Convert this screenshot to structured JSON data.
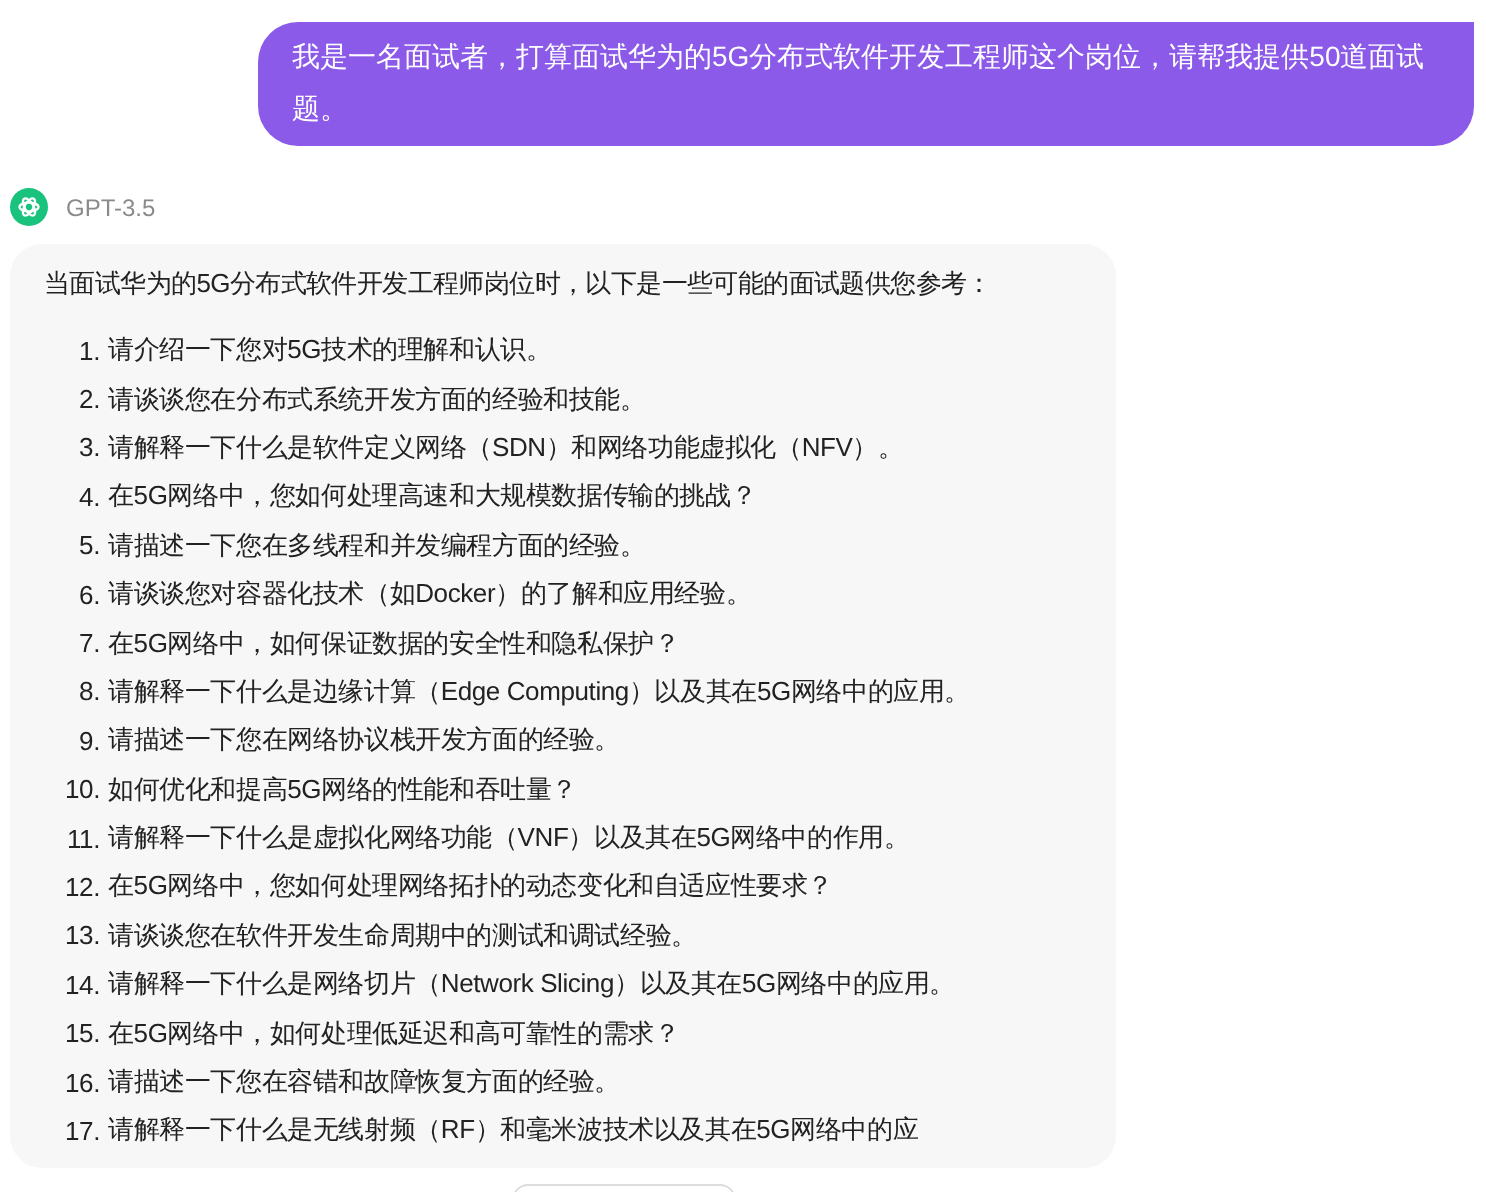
{
  "user_message": {
    "text": "我是一名面试者，打算面试华为的5G分布式软件开发工程师这个岗位，请帮我提供50道面试题。"
  },
  "assistant": {
    "model": "GPT-3.5",
    "intro": "当面试华为的5G分布式软件开发工程师岗位时，以下是一些可能的面试题供您参考：",
    "items": [
      {
        "number": "1.",
        "text": "请介绍一下您对5G技术的理解和认识。"
      },
      {
        "number": "2.",
        "text": "请谈谈您在分布式系统开发方面的经验和技能。"
      },
      {
        "number": "3.",
        "text": "请解释一下什么是软件定义网络（SDN）和网络功能虚拟化（NFV）。"
      },
      {
        "number": "4.",
        "text": "在5G网络中，您如何处理高速和大规模数据传输的挑战？"
      },
      {
        "number": "5.",
        "text": "请描述一下您在多线程和并发编程方面的经验。"
      },
      {
        "number": "6.",
        "text": "请谈谈您对容器化技术（如Docker）的了解和应用经验。"
      },
      {
        "number": "7.",
        "text": "在5G网络中，如何保证数据的安全性和隐私保护？"
      },
      {
        "number": "8.",
        "text": "请解释一下什么是边缘计算（Edge Computing）以及其在5G网络中的应用。"
      },
      {
        "number": "9.",
        "text": "请描述一下您在网络协议栈开发方面的经验。"
      },
      {
        "number": "10.",
        "text": "如何优化和提高5G网络的性能和吞吐量？"
      },
      {
        "number": "11.",
        "text": "请解释一下什么是虚拟化网络功能（VNF）以及其在5G网络中的作用。"
      },
      {
        "number": "12.",
        "text": "在5G网络中，您如何处理网络拓扑的动态变化和自适应性要求？"
      },
      {
        "number": "13.",
        "text": "请谈谈您在软件开发生命周期中的测试和调试经验。"
      },
      {
        "number": "14.",
        "text": "请解释一下什么是网络切片（Network Slicing）以及其在5G网络中的应用。"
      },
      {
        "number": "15.",
        "text": "在5G网络中，如何处理低延迟和高可靠性的需求？"
      },
      {
        "number": "16.",
        "text": "请描述一下您在容错和故障恢复方面的经验。"
      },
      {
        "number": "17.",
        "text": "请解释一下什么是无线射频（RF）和毫米波技术以及其在5G网络中的应"
      }
    ]
  }
}
